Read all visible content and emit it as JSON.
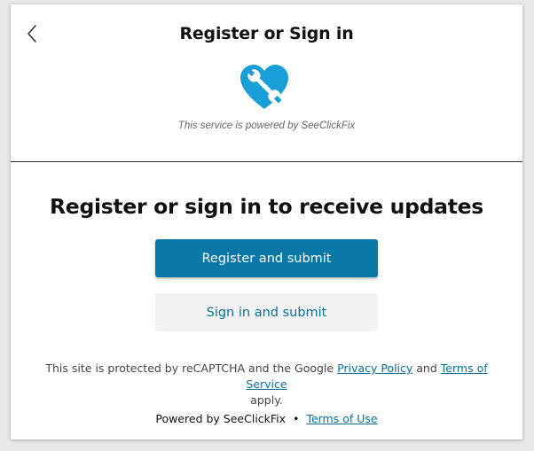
{
  "header": {
    "title": "Register or Sign in",
    "back_icon": "chevron-left-icon",
    "logo_icon": "heart-wrench-icon",
    "powered_text": "This service is powered by SeeClickFix"
  },
  "main": {
    "heading": "Register or sign in to receive updates",
    "register_button": "Register and submit",
    "signin_button": "Sign in and submit"
  },
  "recaptcha": {
    "prefix": "This site is protected by reCAPTCHA and the Google",
    "privacy_link": "Privacy Policy",
    "and": "and",
    "terms_link": "Terms of Service",
    "suffix": "apply."
  },
  "footer": {
    "powered_by": "Powered by SeeClickFix",
    "separator": "•",
    "terms_of_use": "Terms of Use"
  },
  "colors": {
    "primary": "#0a78a6",
    "link": "#0a6f9a",
    "logo": "#1a9ed8"
  }
}
